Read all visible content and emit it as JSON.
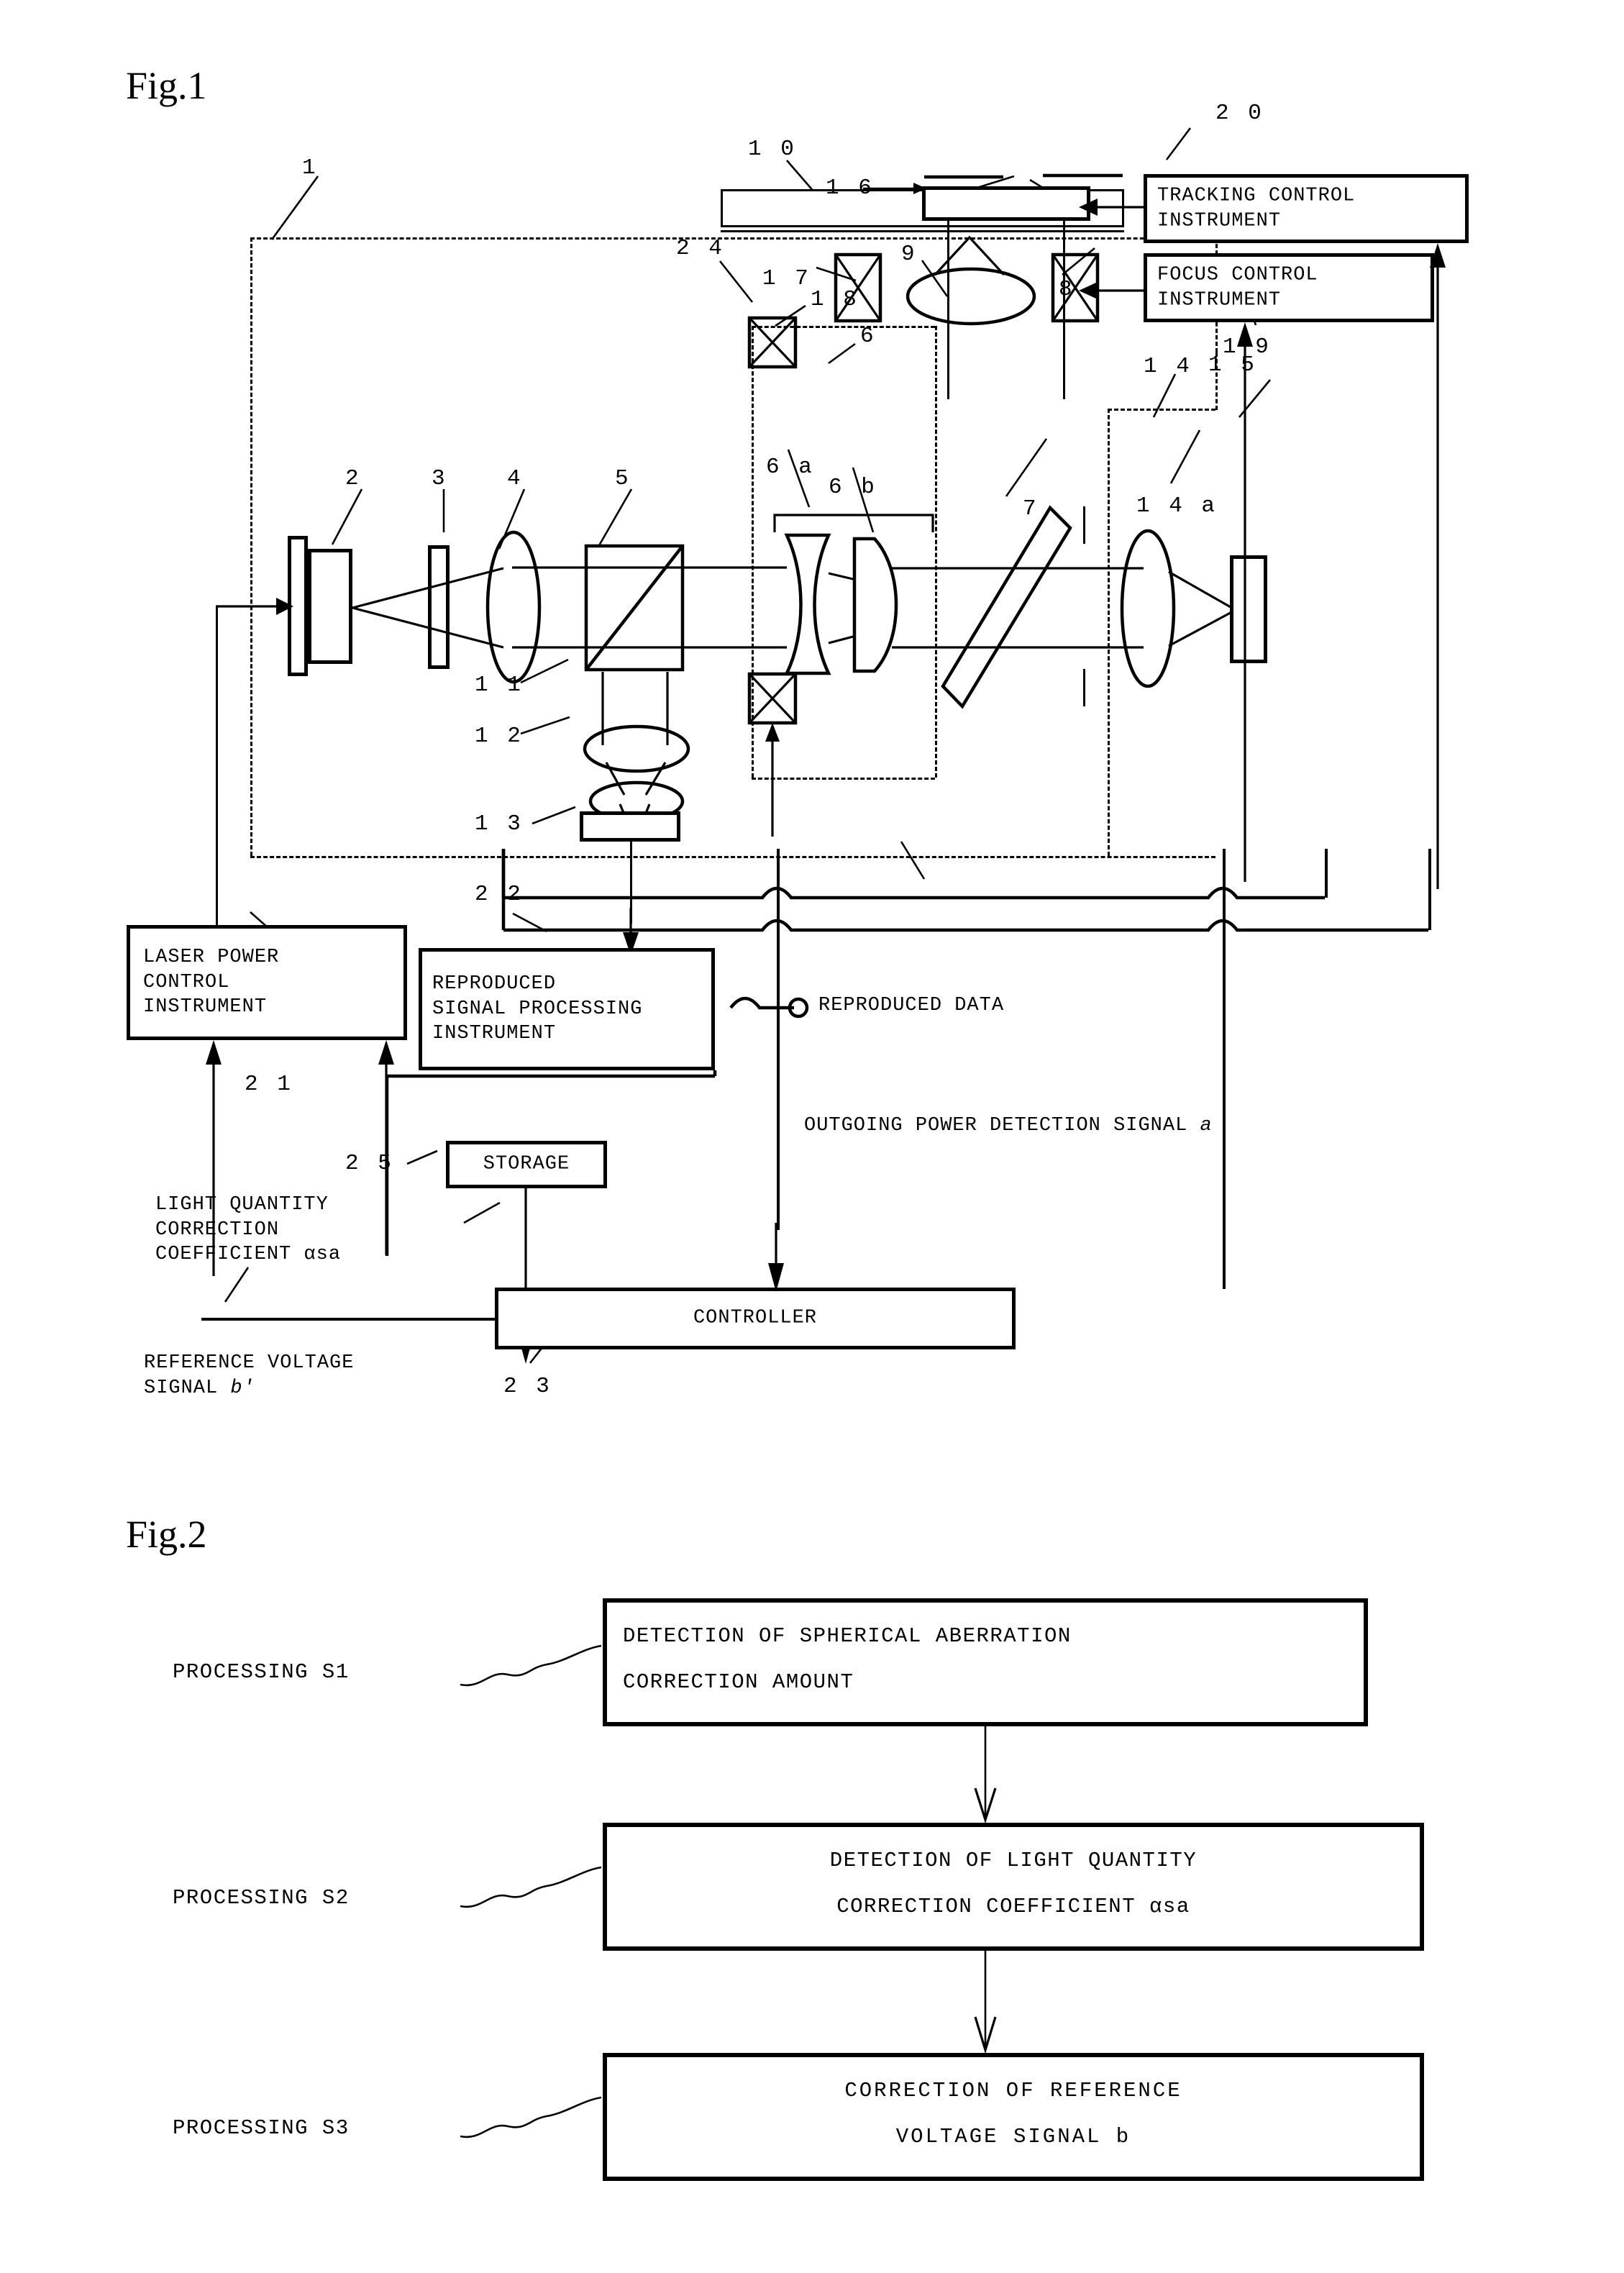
{
  "figures": [
    {
      "id": "fig1",
      "title": "Fig.1"
    },
    {
      "id": "fig2",
      "title": "Fig.2"
    }
  ],
  "fig1": {
    "title": "Fig.1",
    "boxes": {
      "tracking_control": "TRACKING CONTROL\nINSTRUMENT",
      "focus_control": "FOCUS CONTROL\nINSTRUMENT",
      "laser_power_control": "LASER POWER\nCONTROL\nINSTRUMENT",
      "reproduced_signal_processing": "REPRODUCED\nSIGNAL PROCESSING\nINSTRUMENT",
      "storage": "STORAGE",
      "controller": "CONTROLLER"
    },
    "signal_labels": {
      "reproduced_data": "REPRODUCED DATA",
      "outgoing_power": "OUTGOING POWER DETECTION SIGNAL ",
      "outgoing_power_italic": "a",
      "light_quantity": "LIGHT QUANTITY\nCORRECTION\nCOEFFICIENT αsa",
      "reference_voltage": "REFERENCE VOLTAGE\nSIGNAL ",
      "reference_voltage_italic": "b'"
    },
    "reference_numerals": {
      "n1": "1",
      "n2": "2",
      "n3": "3",
      "n4": "4",
      "n5": "5",
      "n6": "6",
      "n6a": "6 a",
      "n6b": "6 b",
      "n7": "7",
      "n8": "8",
      "n9": "9",
      "n10": "1 0",
      "n11": "1 1",
      "n12": "1 2",
      "n13": "1 3",
      "n14": "1 4",
      "n14a": "1 4 a",
      "n15": "1 5",
      "n16": "1 6",
      "n17": "1 7",
      "n18": "1 8",
      "n19": "1 9",
      "n20": "2 0",
      "n21": "2 1",
      "n22": "2 2",
      "n23": "2 3",
      "n24": "2 4",
      "n25": "2 5"
    }
  },
  "fig2": {
    "title": "Fig.2",
    "steps": [
      {
        "label": "PROCESSING S1",
        "text_line1": "DETECTION OF SPHERICAL ABERRATION",
        "text_line2": "CORRECTION AMOUNT"
      },
      {
        "label": "PROCESSING S2",
        "text_line1": "DETECTION OF LIGHT QUANTITY",
        "text_line2": "CORRECTION COEFFICIENT αsa"
      },
      {
        "label": "PROCESSING S3",
        "text_line1": "CORRECTION OF REFERENCE",
        "text_line2": "VOLTAGE SIGNAL b"
      }
    ]
  },
  "colors": {
    "ink": "#000000",
    "paper": "#ffffff"
  }
}
